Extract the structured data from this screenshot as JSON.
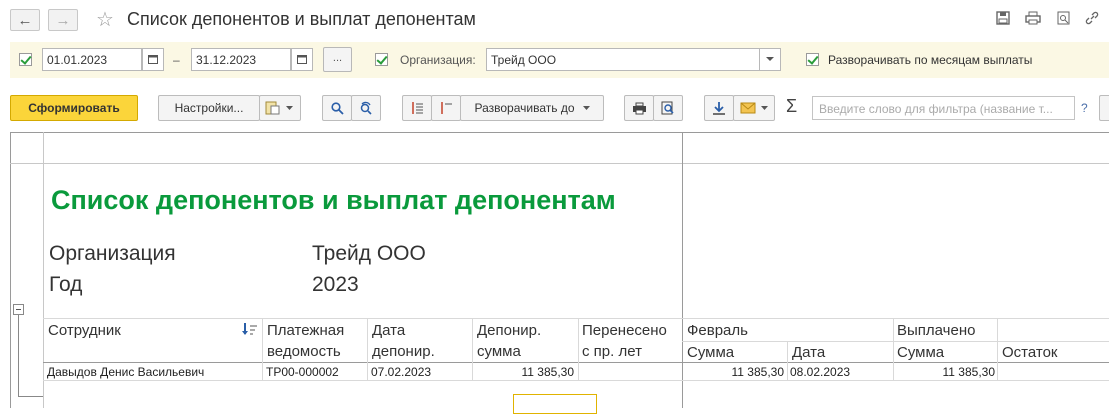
{
  "window": {
    "title": "Список депонентов и выплат депонентам",
    "back_icon": "←",
    "forward_icon": "→",
    "star_icon": "☆"
  },
  "params": {
    "date_from": "01.01.2023",
    "date_sep": "–",
    "date_to": "31.12.2023",
    "more_button": "...",
    "org_label": "Организация:",
    "org_value": "Трейд ООО",
    "expand_label": "Разворачивать по  месяцам выплаты"
  },
  "toolbar": {
    "generate": "Сформировать",
    "settings": "Настройки...",
    "expand_to": "Разворачивать до",
    "filter_placeholder": "Введите слово для фильтра (название т...",
    "help": "?",
    "sigma": "Σ"
  },
  "report": {
    "title": "Список депонентов и выплат депонентам",
    "org_label": "Организация",
    "org_value": "Трейд ООО",
    "year_label": "Год",
    "year_value": "2023",
    "columns": {
      "employee": "Сотрудник",
      "statement_1": "Платежная",
      "statement_2": "ведомость",
      "date_1": "Дата",
      "date_2": "депонир.",
      "sum_1": "Депонир.",
      "sum_2": "сумма",
      "carried_1": "Перенесено",
      "carried_2": "с пр. лет",
      "feb": "Февраль",
      "feb_sum": "Сумма",
      "feb_date": "Дата",
      "paid": "Выплачено",
      "paid_sum": "Сумма",
      "rest": "Остаток"
    },
    "rows": [
      {
        "employee": "Давыдов Денис Васильевич",
        "statement": "ТР00-000002",
        "date": "07.02.2023",
        "sum": "11 385,30",
        "carried": "",
        "feb_sum": "11 385,30",
        "feb_date": "08.02.2023",
        "paid_sum": "11 385,30",
        "rest": ""
      }
    ],
    "title_color": "#0a9a3c"
  }
}
